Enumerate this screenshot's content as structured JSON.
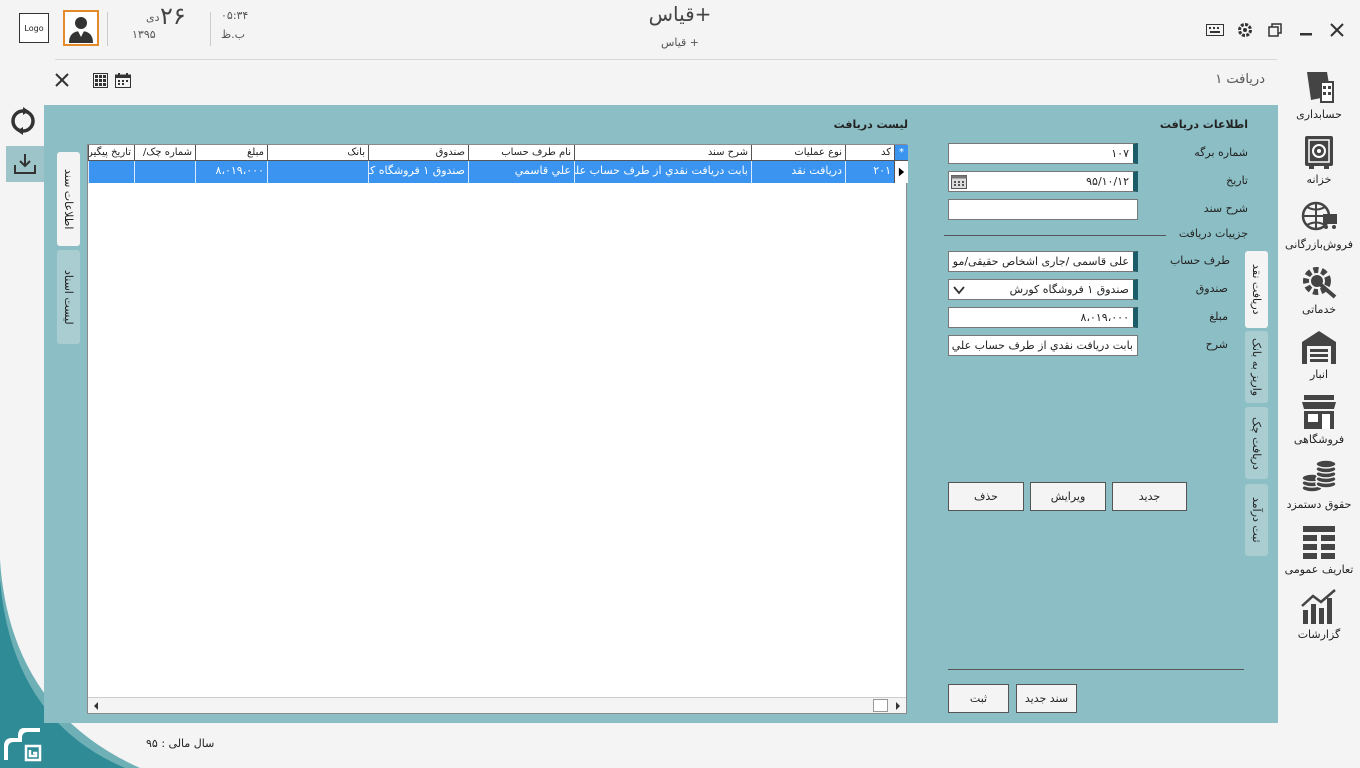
{
  "header": {
    "logo_text": "Logo",
    "date_day": "۲۶",
    "date_month": "دی",
    "date_year": "۱۳۹۵",
    "time": "۰۵:۳۴",
    "ampm": "ب.ظ",
    "app_title": "قیاس+",
    "app_subtitle": "قیاس +"
  },
  "form_title": "دریافت ۱",
  "side_nav": [
    {
      "label": "حسابداری",
      "icon": "accounting-icon"
    },
    {
      "label": "خزانه",
      "icon": "treasury-icon"
    },
    {
      "label": "فروش‌بازرگانی",
      "icon": "commerce-icon"
    },
    {
      "label": "خدماتی",
      "icon": "services-icon"
    },
    {
      "label": "انبار",
      "icon": "warehouse-icon"
    },
    {
      "label": "فروشگاهی",
      "icon": "store-icon"
    },
    {
      "label": "حقوق دستمزد",
      "icon": "payroll-icon"
    },
    {
      "label": "تعاریف عمومی",
      "icon": "definitions-icon"
    },
    {
      "label": "گزارشات",
      "icon": "reports-icon"
    }
  ],
  "receipt_info": {
    "title": "اطلاعات دریافت",
    "voucher_no_label": "شماره برگه",
    "voucher_no": "۱۰۷",
    "date_label": "تاریخ",
    "date": "۹۵/۱۰/۱۲",
    "doc_desc_label": "شرح سند",
    "doc_desc": "",
    "details_label": "جزییات دریافت",
    "account_label": "طرف حساب",
    "account": "علی قاسمی /جاری اشخاص حقیقی/مو",
    "fund_label": "صندوق",
    "fund": "صندوق ۱ فروشگاه کورش",
    "amount_label": "مبلغ",
    "amount": "۸،۰۱۹،۰۰۰",
    "desc_label": "شرح",
    "desc": "بابت دریافت نقدي از طرف حساب علي قاسمي"
  },
  "buttons": {
    "new": "جدید",
    "edit": "ویرایش",
    "delete": "حذف",
    "submit": "ثبت",
    "new_doc": "سند جدید"
  },
  "tabs_right": [
    "دریافت نقد",
    "واریز به بانک",
    "دریافت چک",
    "ثبت درآمد"
  ],
  "tabs_left": [
    "اطلاعات سند",
    "لیست اسناد"
  ],
  "list": {
    "title": "لیست دریافت",
    "star": "*",
    "columns": [
      "کد",
      "نوع عملیات",
      "شرح سند",
      "نام طرف حساب",
      "صندوق",
      "بانک",
      "مبلغ",
      "شماره چک/",
      "تاریخ پیگیری"
    ],
    "rows": [
      [
        "۲۰۱",
        "دریافت نقد",
        "بابت دریافت نقدي از طرف حساب علي قاسمي",
        "علي قاسمي",
        "صندوق ۱ فروشگاه کورش",
        "",
        "۸،۰۱۹،۰۰۰",
        "",
        ""
      ]
    ]
  },
  "footer": {
    "fiscal_year": "سال مالی : ۹۵"
  }
}
